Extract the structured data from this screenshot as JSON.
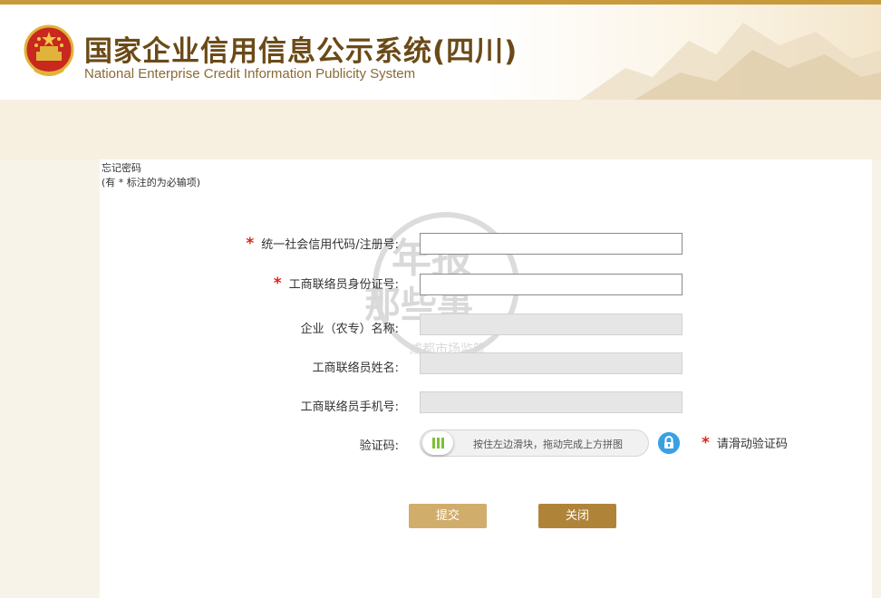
{
  "header": {
    "title_cn": "国家企业信用信息公示系统(四川)",
    "title_en": "National Enterprise Credit Information Publicity System"
  },
  "page": {
    "heading": "忘记密码",
    "note": "(有 * 标注的为必输项)"
  },
  "form": {
    "required_mark": "*",
    "fields": [
      {
        "label": "统一社会信用代码/注册号:",
        "required": true,
        "value": "",
        "disabled": false
      },
      {
        "label": "工商联络员身份证号:",
        "required": true,
        "value": "",
        "disabled": false
      },
      {
        "label": "企业（农专）名称:",
        "required": false,
        "value": "",
        "disabled": true
      },
      {
        "label": "工商联络员姓名:",
        "required": false,
        "value": "",
        "disabled": true
      },
      {
        "label": "工商联络员手机号:",
        "required": false,
        "value": "",
        "disabled": true
      }
    ],
    "captcha": {
      "label": "验证码:",
      "slider_text": "按住左边滑块，拖动完成上方拼图",
      "hint": "请滑动验证码",
      "lock_icon": "lock-icon"
    }
  },
  "buttons": {
    "submit": "提交",
    "close": "关闭"
  },
  "watermark": {
    "line1": "年报",
    "line2": "那些事",
    "line3": "成都市场监管"
  },
  "colors": {
    "brand_gold": "#c89a3c",
    "required_red": "#d9261c",
    "submit_bg": "#d1ad6c",
    "close_bg": "#b08438",
    "lock_blue": "#3aa0e4",
    "slider_knob_green": "#7fbf3a"
  }
}
